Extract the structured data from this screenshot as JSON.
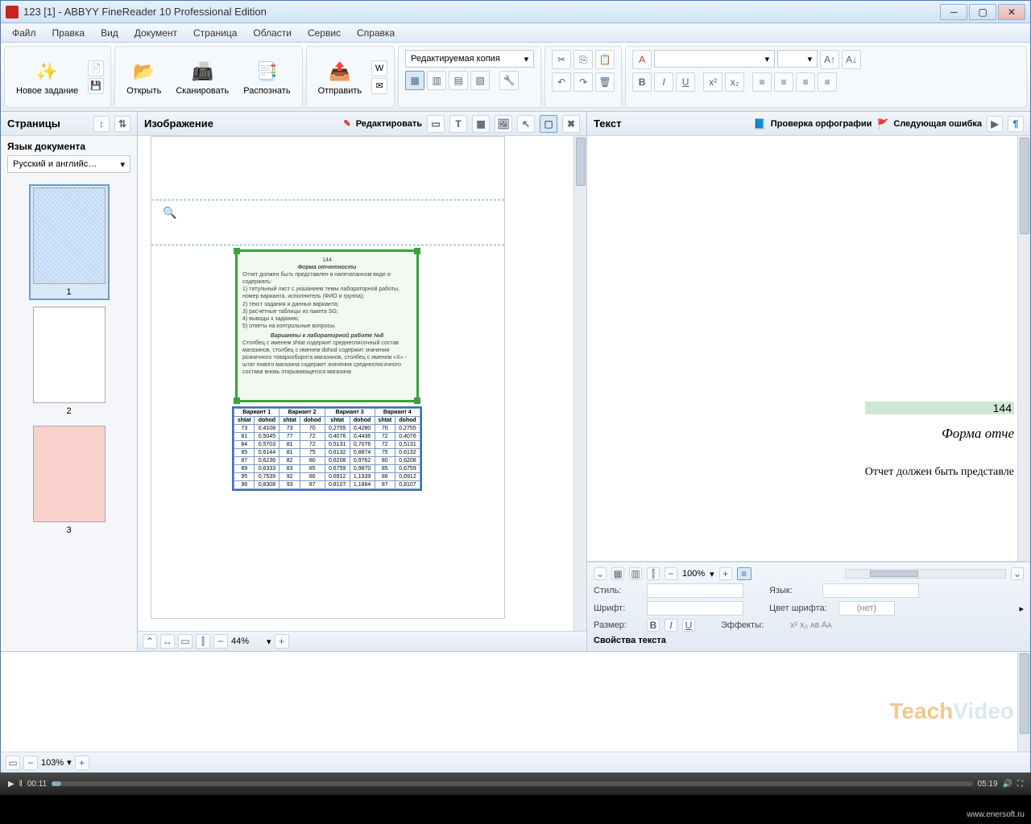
{
  "title": "123 [1] - ABBYY FineReader 10 Professional Edition",
  "menu": {
    "file": "Файл",
    "edit": "Правка",
    "view": "Вид",
    "document": "Документ",
    "page": "Страница",
    "areas": "Области",
    "service": "Сервис",
    "help": "Справка"
  },
  "ribbon": {
    "new_task": "Новое задание",
    "open": "Открыть",
    "scan": "Сканировать",
    "recognize": "Распознать",
    "send": "Отправить",
    "style_drop": "Редактируемая копия"
  },
  "panels": {
    "pages": "Страницы",
    "image": "Изображение",
    "edit": "Редактировать",
    "text": "Текст",
    "spellcheck": "Проверка орфографии",
    "next_error": "Следующая ошибка"
  },
  "lang_label": "Язык документа",
  "lang_value": "Русский и английс…",
  "thumbs": [
    "1",
    "2",
    "3"
  ],
  "img_zoom": "44%",
  "text_zoom": "100%",
  "bottom_zoom": "103%",
  "text_preview": {
    "page": "144",
    "heading": "Форма отче",
    "line": "Отчет должен быть представле"
  },
  "props": {
    "style": "Стиль:",
    "lang": "Язык:",
    "font": "Шрифт:",
    "color": "Цвет шрифта:",
    "color_val": "(нет)",
    "size": "Размер:",
    "effects": "Эффекты:",
    "title": "Свойства текста"
  },
  "scan_text": {
    "page": "144",
    "h": "Форма отчетности",
    "intro": "Отчет должен быть представлен в напечатанном виде и содержать:",
    "items": [
      "1)  титульный лист с указанием темы лабораторной работы, номер варианта, исполнитель (ФИО и группа);",
      "2)  текст задания и данных варианта;",
      "3)  расчетные таблицы из пакета SG;",
      "4)  выводы к заданию;",
      "5)  ответы на контрольные вопросы."
    ],
    "h2": "Варианты к лабораторной работе №8",
    "desc": "Столбец с именем shtat содержит среднесписочный состав магазинов, столбец с именем dohod содержит значения розничного товарооборота магазинов, столбец с именем «X» - штат нового магазина содержит значения среднесписочного состава вновь открывающегося магазина"
  },
  "table": {
    "headers": [
      "Вариант 1",
      "Вариант 2",
      "Вариант 3",
      "Вариант 4"
    ],
    "sub": [
      "shtat",
      "dohod",
      "shtat",
      "dohod",
      "shtat",
      "dohod",
      "shtat",
      "dohod"
    ],
    "rows": [
      [
        "73",
        "0,4108",
        "73",
        "70",
        "0,2755",
        "0,4280",
        "70",
        "0,2755"
      ],
      [
        "81",
        "0,5045",
        "77",
        "72",
        "0,4076",
        "0,4436",
        "72",
        "0,4076"
      ],
      [
        "84",
        "0,5703",
        "81",
        "72",
        "0,5131",
        "0,7076",
        "72",
        "0,5131"
      ],
      [
        "85",
        "0,6144",
        "81",
        "75",
        "0,6132",
        "0,8874",
        "75",
        "0,6132"
      ],
      [
        "87",
        "0,6236",
        "82",
        "80",
        "0,6208",
        "0,9762",
        "80",
        "0,6208"
      ],
      [
        "89",
        "0,6333",
        "83",
        "85",
        "0,6759",
        "0,9870",
        "85",
        "0,6759"
      ],
      [
        "95",
        "0,7539",
        "92",
        "86",
        "0,6912",
        "1,1339",
        "86",
        "0,6912"
      ],
      [
        "98",
        "0,8308",
        "93",
        "87",
        "0,8107",
        "1,1864",
        "87",
        "0,8107"
      ]
    ]
  },
  "player": {
    "cur": "00:11",
    "total": "05:19"
  },
  "watermark_url": "www.enersoft.ru",
  "watermark1": "Teach",
  "watermark2": "Video"
}
